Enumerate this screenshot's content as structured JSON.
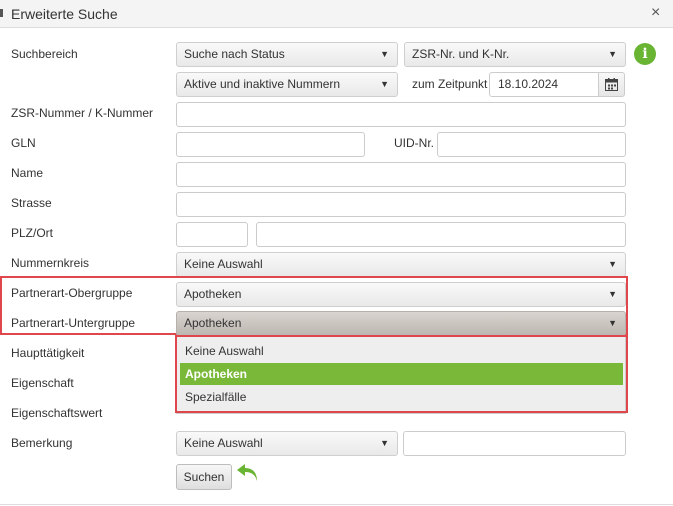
{
  "dialog": {
    "title": "Erweiterte Suche",
    "close_symbol": "×"
  },
  "labels": {
    "suchbereich": "Suchbereich",
    "zsr": "ZSR-Nummer / K-Nummer",
    "gln": "GLN",
    "uid": "UID-Nr.",
    "name": "Name",
    "strasse": "Strasse",
    "plz_ort": "PLZ/Ort",
    "nummernkreis": "Nummernkreis",
    "obergruppe": "Partnerart-Obergruppe",
    "untergruppe": "Partnerart-Untergruppe",
    "haupttaetigkeit": "Haupttätigkeit",
    "eigenschaft": "Eigenschaft",
    "eigenschaftswert": "Eigenschaftswert",
    "bemerkung": "Bemerkung",
    "zum_zeitpunkt": "zum Zeitpunkt"
  },
  "selects": {
    "suche_nach": "Suche nach Status",
    "zsr_typ": "ZSR-Nr. und K-Nr.",
    "aktiv": "Aktive und inaktive Nummern",
    "nummernkreis": "Keine Auswahl",
    "obergruppe": "Apotheken",
    "untergruppe": "Apotheken",
    "bemerkung": "Keine Auswahl"
  },
  "date_value": "18.10.2024",
  "dropdown_options": [
    "Keine Auswahl",
    "Apotheken",
    "Spezialfälle"
  ],
  "buttons": {
    "suchen": "Suchen"
  },
  "icons": {
    "info": "i",
    "caret": "▼"
  },
  "colors": {
    "accent_green": "#7ab83a",
    "highlight_red": "#e0474c"
  }
}
